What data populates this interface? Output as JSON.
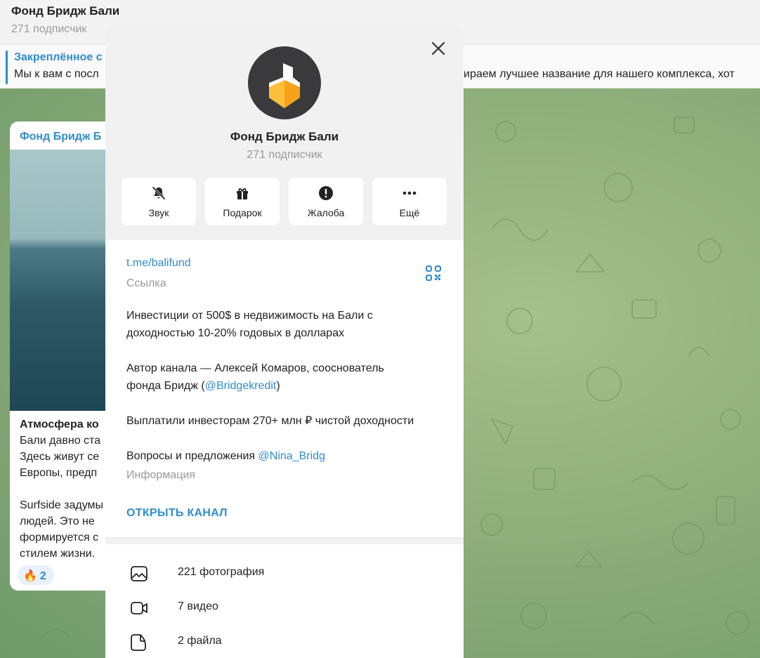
{
  "chat": {
    "title": "Фонд Бридж Бали",
    "subscribers": "271 подписчик"
  },
  "pinned": {
    "title": "Закреплённое с",
    "text_left": "Мы к вам с посл",
    "text_right": "ираем лучшее название для нашего комплекса, хот"
  },
  "post": {
    "channel": "Фонд Бридж Б",
    "lines": [
      "Атмосфера ко",
      "Бали давно ста",
      "Здесь живут се",
      "Европы, предп",
      "",
      "Surfside задумы",
      "людей. Это не",
      "формируется с",
      "стилем жизни."
    ],
    "reaction_emoji": "🔥",
    "reaction_count": "2"
  },
  "profile": {
    "title": "Фонд Бридж Бали",
    "subscribers": "271 подписчик",
    "actions": [
      {
        "label": "Звук",
        "icon": "bell-muted-icon"
      },
      {
        "label": "Подарок",
        "icon": "gift-icon"
      },
      {
        "label": "Жалоба",
        "icon": "report-icon"
      },
      {
        "label": "Ещё",
        "icon": "more-icon"
      }
    ],
    "link": "t.me/balifund",
    "link_caption": "Ссылка",
    "about": {
      "p1_line1": "Инвестиции от 500$ в недвижимость на Бали  с",
      "p1_line2": "доходностью 10-20% годовых в долларах",
      "p2_line1": "Автор канала — Алексей Комаров, сооснователь",
      "p2_line2_prefix": "фонда Бридж (",
      "p2_mention": "@Bridgekredit",
      "p2_line2_suffix": ")",
      "p3": "Выплатили инвесторам 270+ млн ₽ чистой доходности",
      "p4_prefix": "Вопросы и предложения ",
      "p4_mention": "@Nina_Bridg"
    },
    "about_caption": "Информация",
    "open_channel": "ОТКРЫТЬ КАНАЛ",
    "media": [
      {
        "label": "221 фотография",
        "icon": "photo-icon"
      },
      {
        "label": "7 видео",
        "icon": "video-icon"
      },
      {
        "label": "2 файла",
        "icon": "file-icon"
      }
    ]
  },
  "colors": {
    "accent": "#2f8ccf",
    "avatar_bg": "#3a3a3c",
    "avatar_orange": "#f7a21b",
    "wallpaper": "#8fae7a"
  }
}
